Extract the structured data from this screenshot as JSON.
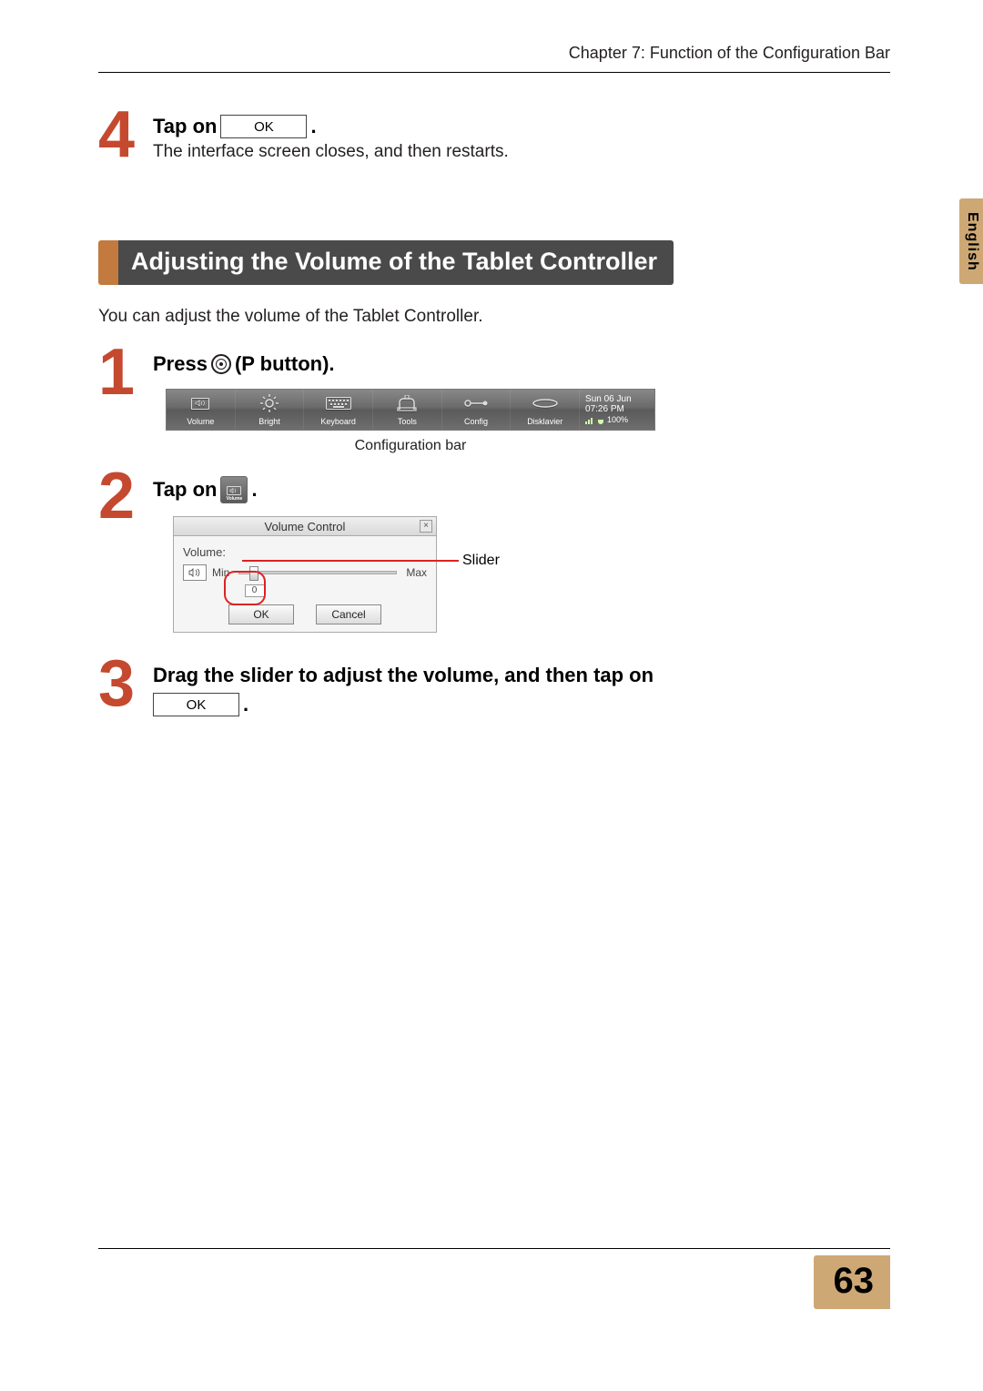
{
  "chapter_header": "Chapter 7: Function of the Configuration Bar",
  "side_tab": "English",
  "page_number": "63",
  "step4": {
    "num": "4",
    "title_prefix": "Tap on",
    "ok_label": "OK",
    "period": ".",
    "desc": "The interface screen closes, and then restarts."
  },
  "section_title": "Adjusting the Volume of the Tablet Controller",
  "intro": "You can adjust the volume of the Tablet Controller.",
  "step1": {
    "num": "1",
    "title_prefix": "Press",
    "title_suffix": "(P button).",
    "config_bar_caption": "Configuration bar",
    "items": [
      {
        "label": "Volume"
      },
      {
        "label": "Bright"
      },
      {
        "label": "Keyboard"
      },
      {
        "label": "Tools"
      },
      {
        "label": "Config"
      },
      {
        "label": "Disklavier"
      }
    ],
    "clock": {
      "day": "Sun 06 Jun",
      "time": "07:26 PM",
      "battery": "100%"
    }
  },
  "step2": {
    "num": "2",
    "title_prefix": "Tap on",
    "period": ".",
    "tile_label": "Volume",
    "dialog": {
      "title": "Volume Control",
      "close": "×",
      "volume_label": "Volume:",
      "min": "Min",
      "max": "Max",
      "value": "0",
      "ok": "OK",
      "cancel": "Cancel"
    },
    "annot_slider": "Slider"
  },
  "step3": {
    "num": "3",
    "title": "Drag the slider to adjust the volume, and then tap on",
    "ok_label": "OK",
    "period": "."
  }
}
